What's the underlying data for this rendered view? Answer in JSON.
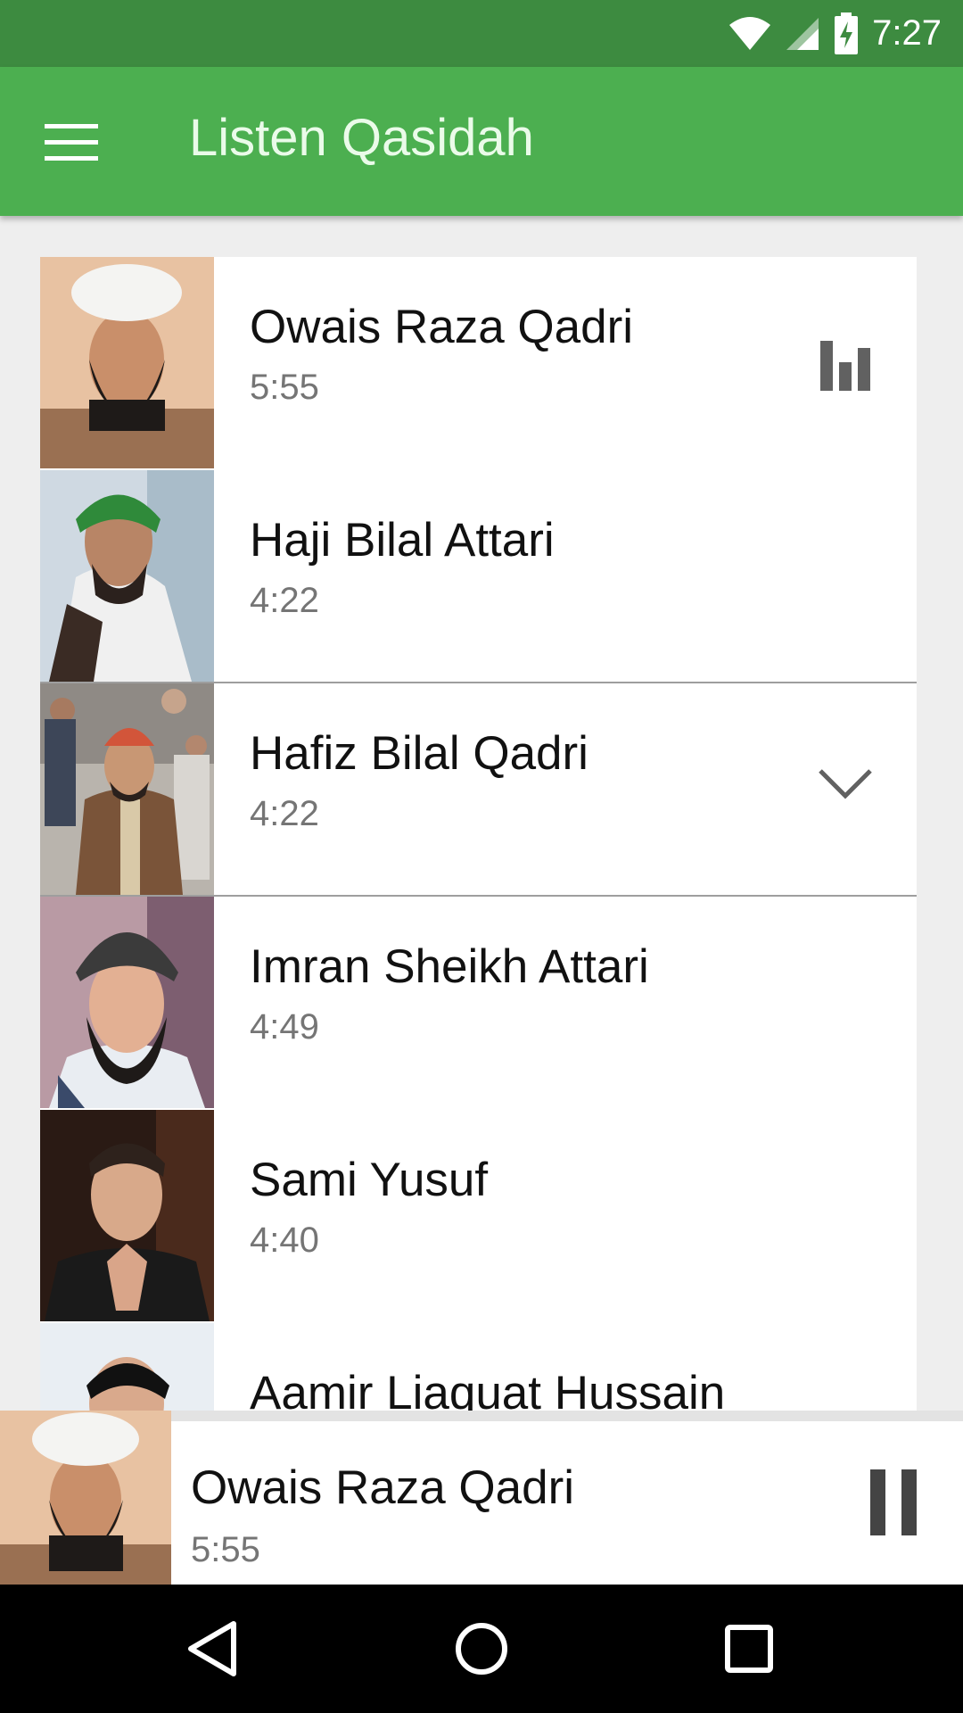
{
  "status": {
    "time": "7:27"
  },
  "appbar": {
    "title": "Listen Qasidah"
  },
  "tracks": [
    {
      "name": "Owais Raza Qadri",
      "duration": "5:55",
      "icon": "equalizer-icon"
    },
    {
      "name": "Haji Bilal Attari",
      "duration": "4:22"
    },
    {
      "name": "Hafiz Bilal Qadri",
      "duration": "4:22",
      "icon": "chevron-down-icon"
    },
    {
      "name": "Imran Sheikh Attari",
      "duration": "4:49"
    },
    {
      "name": "Sami Yusuf",
      "duration": "4:40"
    },
    {
      "name": "Aamir Liaquat Hussain",
      "duration": ""
    }
  ],
  "player": {
    "name": "Owais Raza Qadri",
    "duration": "5:55",
    "state_icon": "pause-icon"
  },
  "colors": {
    "appbar": "#4caf50",
    "statusbar": "#3d8b40"
  }
}
